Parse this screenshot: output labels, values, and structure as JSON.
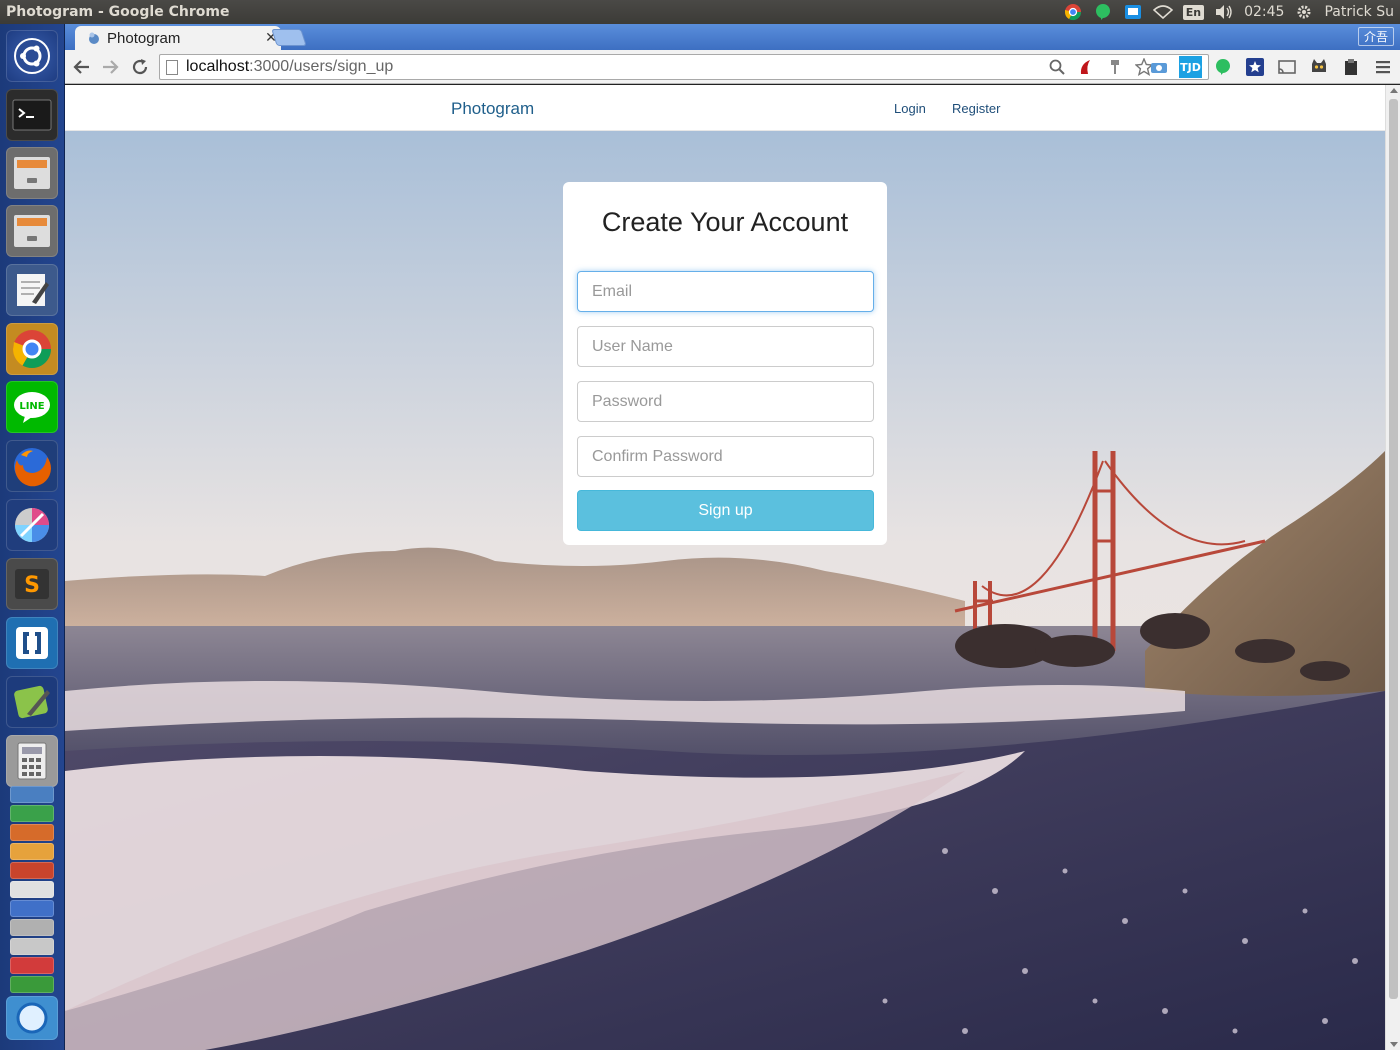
{
  "system_panel": {
    "window_title": "Photogram - Google Chrome",
    "keyboard_layout": "En",
    "time": "02:45",
    "user": "Patrick Su"
  },
  "launcher": {
    "apps": [
      "ubuntu-dash",
      "terminal",
      "files",
      "files-2",
      "text-editor",
      "chrome",
      "line",
      "firefox",
      "color-picker",
      "sublime-text",
      "bracket-app",
      "notes",
      "calculator"
    ]
  },
  "browser": {
    "tab_title": "Photogram",
    "ime_label": "介吾",
    "url_host": "localhost",
    "url_path": ":3000/users/sign_up",
    "extension_badge": "TJD"
  },
  "site": {
    "brand": "Photogram",
    "nav": {
      "login": "Login",
      "register": "Register"
    }
  },
  "form": {
    "title": "Create Your Account",
    "email_placeholder": "Email",
    "username_placeholder": "User Name",
    "password_placeholder": "Password",
    "confirm_placeholder": "Confirm Password",
    "submit_label": "Sign up"
  },
  "colors": {
    "brand_link": "#1f5f8b",
    "button": "#5bc0de",
    "focus_ring": "#66afe9",
    "launcher": "#23458f",
    "tabstrip": "#4a7fd0"
  }
}
